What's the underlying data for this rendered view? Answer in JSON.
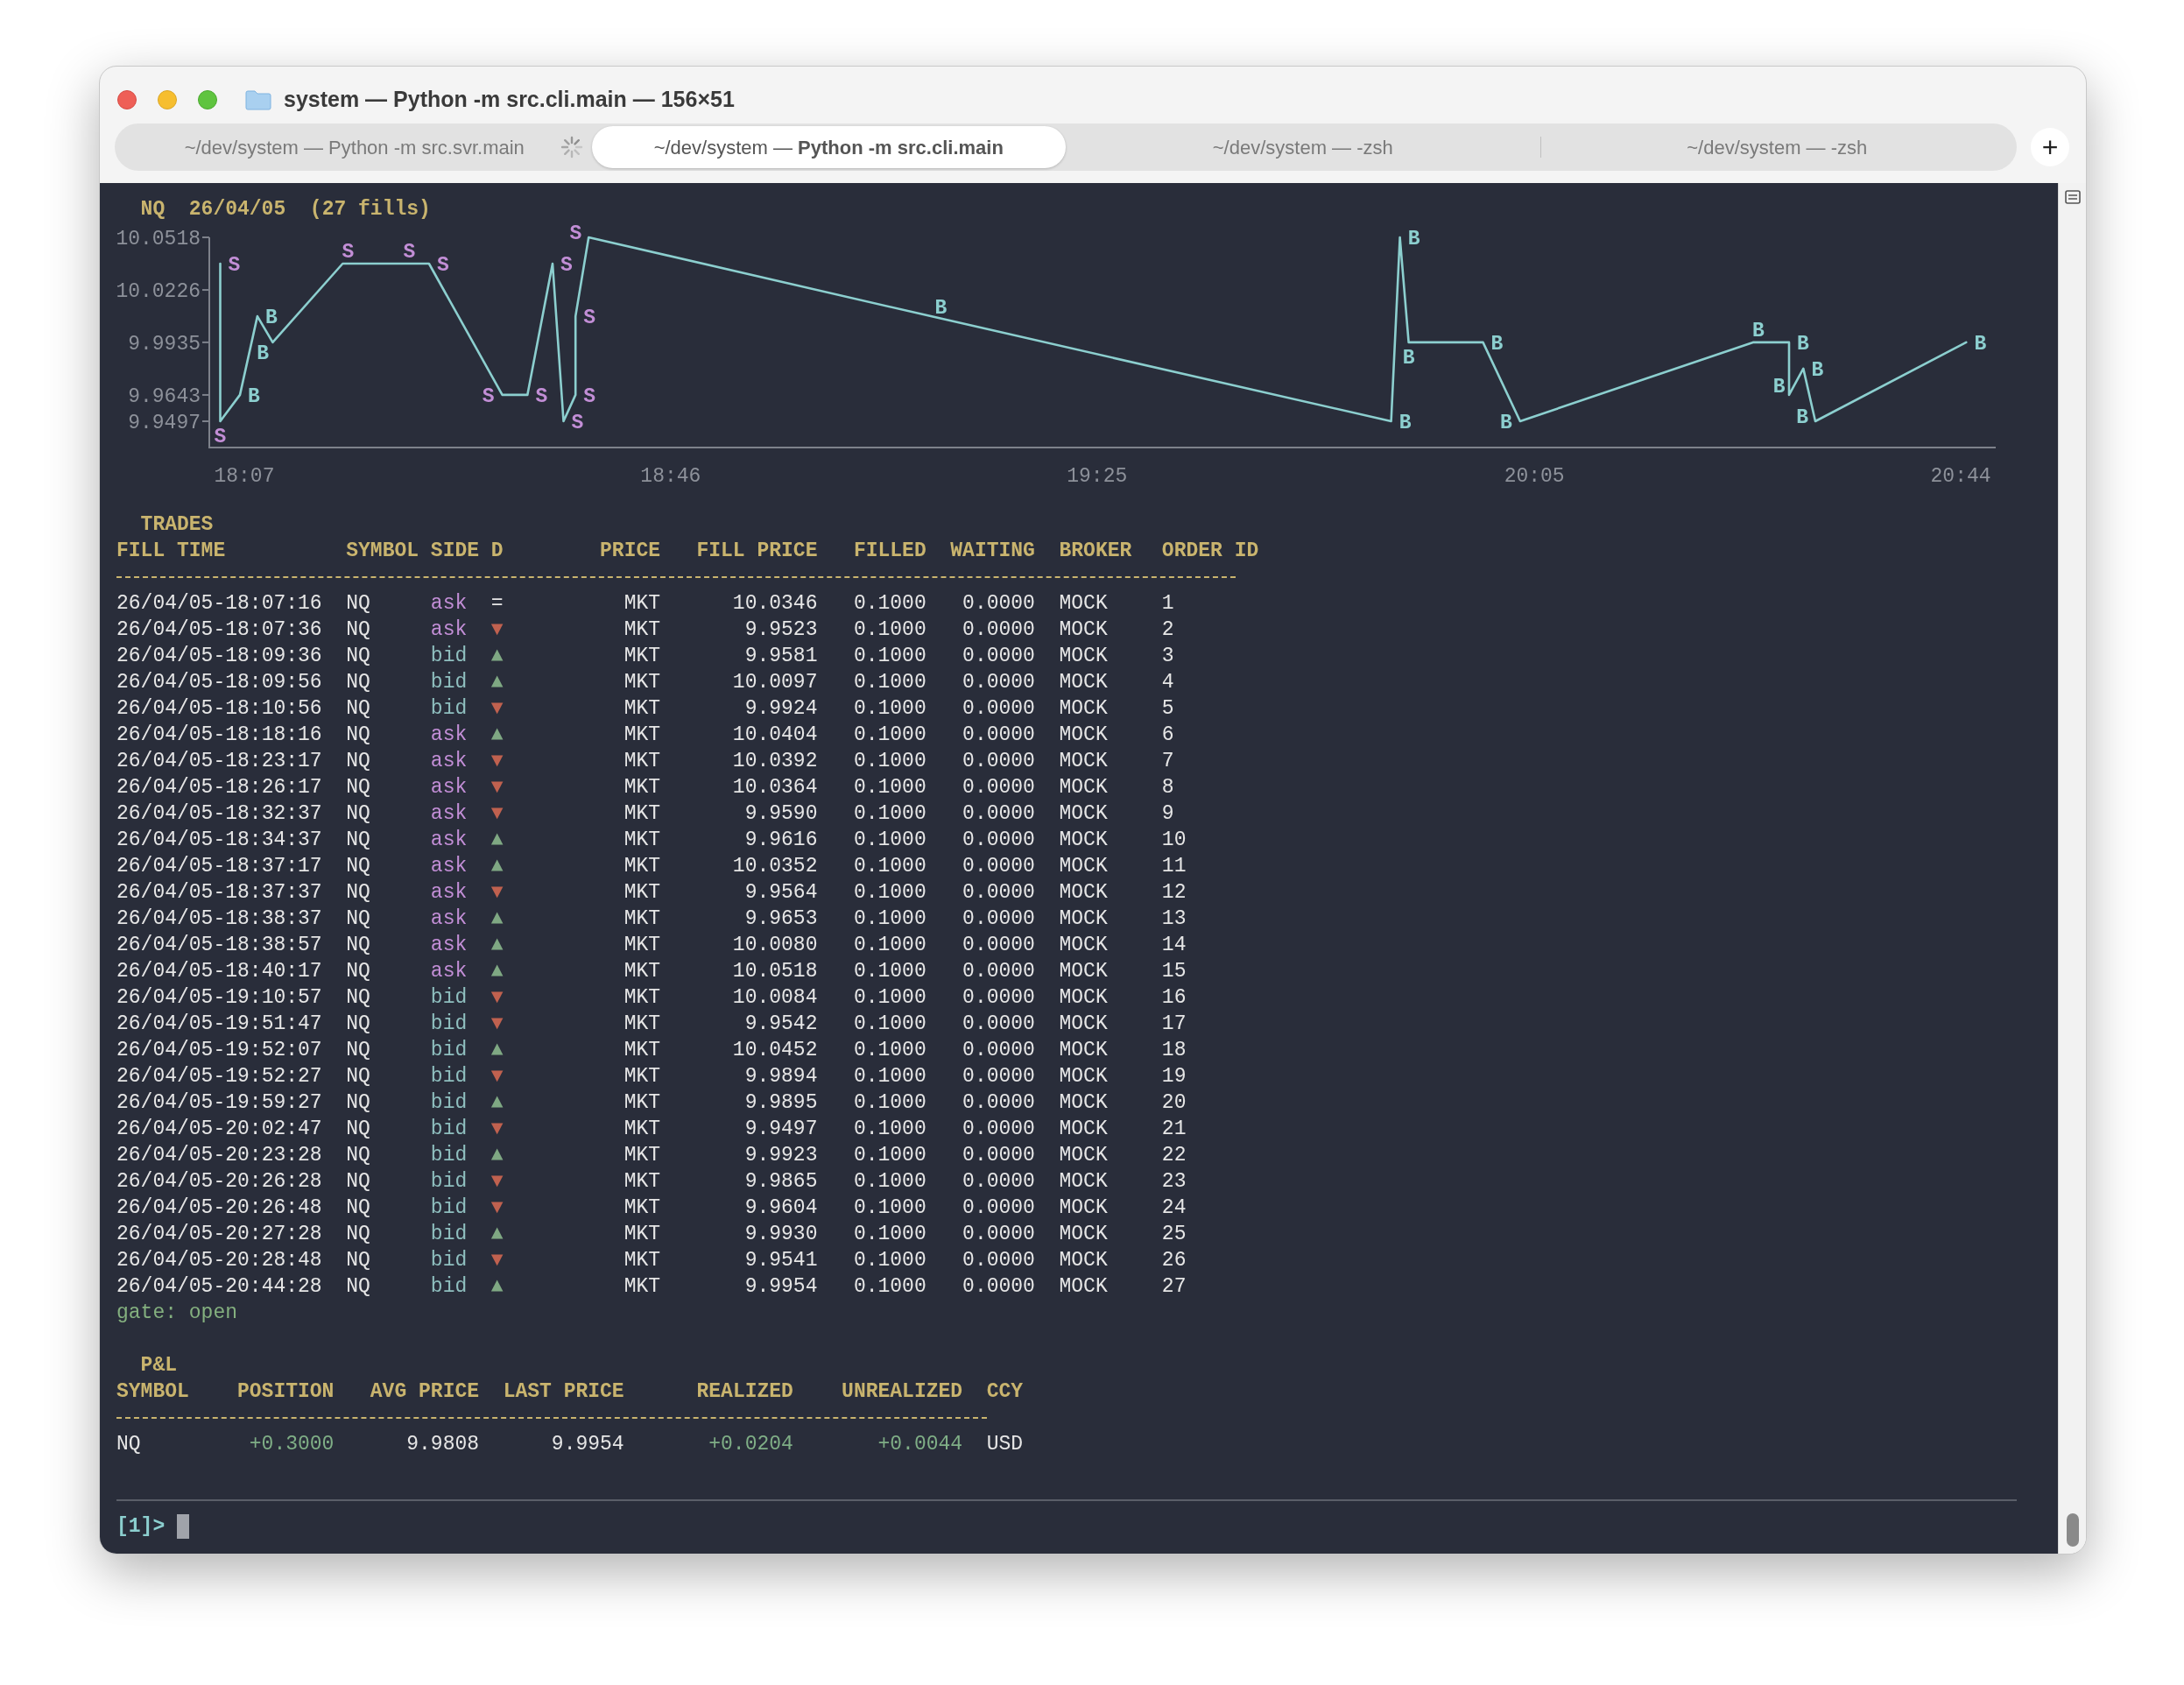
{
  "window": {
    "title": "system — Python -m src.cli.main — 156×51"
  },
  "tabs": [
    {
      "label": "~/dev/system — Python -m src.svr.main",
      "selected": false,
      "busy": true
    },
    {
      "label": "~/dev/system — **Python -m src.cli.main**",
      "selected": true,
      "busy": false
    },
    {
      "label": "~/dev/system — -zsh",
      "selected": false,
      "busy": false
    },
    {
      "label": "~/dev/system — -zsh",
      "selected": false,
      "busy": false
    }
  ],
  "new_tab_button": "+",
  "chart": {
    "title": "NQ  26/04/05  (27 fills)",
    "chart_data": {
      "type": "line",
      "xlim": [
        1083.8,
        1247.2
      ],
      "ylim": [
        9.9351,
        10.0518
      ],
      "xticks": [
        {
          "value": 1087,
          "label": "18:07"
        },
        {
          "value": 1126,
          "label": "18:46"
        },
        {
          "value": 1165,
          "label": "19:25"
        },
        {
          "value": 1205,
          "label": "20:05"
        },
        {
          "value": 1244,
          "label": "20:44"
        }
      ],
      "yticks": [
        10.0518,
        10.0226,
        9.9935,
        9.9643,
        9.9497
      ],
      "x": [
        1084.8,
        1084.8,
        1086.6,
        1088.2,
        1089.6,
        1096.0,
        1101.6,
        1103.9,
        1110.6,
        1112.9,
        1115.2,
        1116.2,
        1117.3,
        1117.3,
        1118.5,
        1149.8,
        1191.9,
        1192.7,
        1193.5,
        1200.3,
        1203.7,
        1225.0,
        1228.3,
        1228.3,
        1229.6,
        1230.7,
        1244.5
      ],
      "series": [
        {
          "color": "#8ccfcf",
          "values": [
            10.0372,
            9.9497,
            9.9643,
            10.008,
            9.9935,
            10.0372,
            10.0372,
            10.0372,
            9.9643,
            9.9643,
            10.0372,
            9.9497,
            9.9643,
            10.008,
            10.0518,
            10.008,
            9.9497,
            10.0518,
            9.9935,
            9.9935,
            9.9497,
            9.9935,
            9.9935,
            9.9643,
            9.9789,
            9.9497,
            9.9935
          ]
        }
      ]
    },
    "markers": [
      {
        "text": "S",
        "color": "#c28ed6"
      },
      {
        "text": "S",
        "color": "#c28ed6"
      },
      {
        "text": "B",
        "color": "#8ccfcf"
      },
      {
        "text": "B",
        "color": "#8ccfcf"
      },
      {
        "text": "B",
        "color": "#8ccfcf"
      },
      {
        "text": "S",
        "color": "#c28ed6"
      },
      {
        "text": "S",
        "color": "#c28ed6"
      },
      {
        "text": "S",
        "color": "#c28ed6"
      },
      {
        "text": "S",
        "color": "#c28ed6"
      },
      {
        "text": "S",
        "color": "#c28ed6"
      },
      {
        "text": "S",
        "color": "#c28ed6"
      },
      {
        "text": "S",
        "color": "#c28ed6"
      },
      {
        "text": "S",
        "color": "#c28ed6"
      },
      {
        "text": "S",
        "color": "#c28ed6"
      },
      {
        "text": "S",
        "color": "#c28ed6"
      },
      {
        "text": "B",
        "color": "#8ccfcf"
      },
      {
        "text": "B",
        "color": "#8ccfcf"
      },
      {
        "text": "B",
        "color": "#8ccfcf"
      },
      {
        "text": "B",
        "color": "#8ccfcf"
      },
      {
        "text": "B",
        "color": "#8ccfcf"
      },
      {
        "text": "B",
        "color": "#8ccfcf"
      },
      {
        "text": "B",
        "color": "#8ccfcf"
      },
      {
        "text": "B",
        "color": "#8ccfcf"
      },
      {
        "text": "B",
        "color": "#8ccfcf"
      },
      {
        "text": "B",
        "color": "#8ccfcf"
      },
      {
        "text": "B",
        "color": "#8ccfcf"
      },
      {
        "text": "B",
        "color": "#8ccfcf"
      }
    ]
  },
  "trades": {
    "title": "TRADES",
    "columns": [
      "FILL TIME",
      "SYMBOL",
      "SIDE",
      "D",
      "PRICE",
      "FILL PRICE",
      "FILLED",
      "WAITING",
      "BROKER",
      "ORDER ID"
    ],
    "rows": [
      {
        "fill_time": "26/04/05-18:07:16",
        "symbol": "NQ",
        "side": {
          "text": "ask",
          "color": "#c28ed6"
        },
        "d": {
          "text": "=",
          "color": "#e6e6e6"
        },
        "price": "MKT",
        "fill_price": "10.0346",
        "filled": "0.1000",
        "waiting": "0.0000",
        "broker": "MOCK",
        "order_id": "1"
      },
      {
        "fill_time": "26/04/05-18:07:36",
        "symbol": "NQ",
        "side": {
          "text": "ask",
          "color": "#c28ed6"
        },
        "d": {
          "text": "▼",
          "color": "#c0614f"
        },
        "price": "MKT",
        "fill_price": "9.9523",
        "filled": "0.1000",
        "waiting": "0.0000",
        "broker": "MOCK",
        "order_id": "2"
      },
      {
        "fill_time": "26/04/05-18:09:36",
        "symbol": "NQ",
        "side": {
          "text": "bid",
          "color": "#8fbfbf"
        },
        "d": {
          "text": "▲",
          "color": "#7fa883"
        },
        "price": "MKT",
        "fill_price": "9.9581",
        "filled": "0.1000",
        "waiting": "0.0000",
        "broker": "MOCK",
        "order_id": "3"
      },
      {
        "fill_time": "26/04/05-18:09:56",
        "symbol": "NQ",
        "side": {
          "text": "bid",
          "color": "#8fbfbf"
        },
        "d": {
          "text": "▲",
          "color": "#7fa883"
        },
        "price": "MKT",
        "fill_price": "10.0097",
        "filled": "0.1000",
        "waiting": "0.0000",
        "broker": "MOCK",
        "order_id": "4"
      },
      {
        "fill_time": "26/04/05-18:10:56",
        "symbol": "NQ",
        "side": {
          "text": "bid",
          "color": "#8fbfbf"
        },
        "d": {
          "text": "▼",
          "color": "#c0614f"
        },
        "price": "MKT",
        "fill_price": "9.9924",
        "filled": "0.1000",
        "waiting": "0.0000",
        "broker": "MOCK",
        "order_id": "5"
      },
      {
        "fill_time": "26/04/05-18:18:16",
        "symbol": "NQ",
        "side": {
          "text": "ask",
          "color": "#c28ed6"
        },
        "d": {
          "text": "▲",
          "color": "#7fa883"
        },
        "price": "MKT",
        "fill_price": "10.0404",
        "filled": "0.1000",
        "waiting": "0.0000",
        "broker": "MOCK",
        "order_id": "6"
      },
      {
        "fill_time": "26/04/05-18:23:17",
        "symbol": "NQ",
        "side": {
          "text": "ask",
          "color": "#c28ed6"
        },
        "d": {
          "text": "▼",
          "color": "#c0614f"
        },
        "price": "MKT",
        "fill_price": "10.0392",
        "filled": "0.1000",
        "waiting": "0.0000",
        "broker": "MOCK",
        "order_id": "7"
      },
      {
        "fill_time": "26/04/05-18:26:17",
        "symbol": "NQ",
        "side": {
          "text": "ask",
          "color": "#c28ed6"
        },
        "d": {
          "text": "▼",
          "color": "#c0614f"
        },
        "price": "MKT",
        "fill_price": "10.0364",
        "filled": "0.1000",
        "waiting": "0.0000",
        "broker": "MOCK",
        "order_id": "8"
      },
      {
        "fill_time": "26/04/05-18:32:37",
        "symbol": "NQ",
        "side": {
          "text": "ask",
          "color": "#c28ed6"
        },
        "d": {
          "text": "▼",
          "color": "#c0614f"
        },
        "price": "MKT",
        "fill_price": "9.9590",
        "filled": "0.1000",
        "waiting": "0.0000",
        "broker": "MOCK",
        "order_id": "9"
      },
      {
        "fill_time": "26/04/05-18:34:37",
        "symbol": "NQ",
        "side": {
          "text": "ask",
          "color": "#c28ed6"
        },
        "d": {
          "text": "▲",
          "color": "#7fa883"
        },
        "price": "MKT",
        "fill_price": "9.9616",
        "filled": "0.1000",
        "waiting": "0.0000",
        "broker": "MOCK",
        "order_id": "10"
      },
      {
        "fill_time": "26/04/05-18:37:17",
        "symbol": "NQ",
        "side": {
          "text": "ask",
          "color": "#c28ed6"
        },
        "d": {
          "text": "▲",
          "color": "#7fa883"
        },
        "price": "MKT",
        "fill_price": "10.0352",
        "filled": "0.1000",
        "waiting": "0.0000",
        "broker": "MOCK",
        "order_id": "11"
      },
      {
        "fill_time": "26/04/05-18:37:37",
        "symbol": "NQ",
        "side": {
          "text": "ask",
          "color": "#c28ed6"
        },
        "d": {
          "text": "▼",
          "color": "#c0614f"
        },
        "price": "MKT",
        "fill_price": "9.9564",
        "filled": "0.1000",
        "waiting": "0.0000",
        "broker": "MOCK",
        "order_id": "12"
      },
      {
        "fill_time": "26/04/05-18:38:37",
        "symbol": "NQ",
        "side": {
          "text": "ask",
          "color": "#c28ed6"
        },
        "d": {
          "text": "▲",
          "color": "#7fa883"
        },
        "price": "MKT",
        "fill_price": "9.9653",
        "filled": "0.1000",
        "waiting": "0.0000",
        "broker": "MOCK",
        "order_id": "13"
      },
      {
        "fill_time": "26/04/05-18:38:57",
        "symbol": "NQ",
        "side": {
          "text": "ask",
          "color": "#c28ed6"
        },
        "d": {
          "text": "▲",
          "color": "#7fa883"
        },
        "price": "MKT",
        "fill_price": "10.0080",
        "filled": "0.1000",
        "waiting": "0.0000",
        "broker": "MOCK",
        "order_id": "14"
      },
      {
        "fill_time": "26/04/05-18:40:17",
        "symbol": "NQ",
        "side": {
          "text": "ask",
          "color": "#c28ed6"
        },
        "d": {
          "text": "▲",
          "color": "#7fa883"
        },
        "price": "MKT",
        "fill_price": "10.0518",
        "filled": "0.1000",
        "waiting": "0.0000",
        "broker": "MOCK",
        "order_id": "15"
      },
      {
        "fill_time": "26/04/05-19:10:57",
        "symbol": "NQ",
        "side": {
          "text": "bid",
          "color": "#8fbfbf"
        },
        "d": {
          "text": "▼",
          "color": "#c0614f"
        },
        "price": "MKT",
        "fill_price": "10.0084",
        "filled": "0.1000",
        "waiting": "0.0000",
        "broker": "MOCK",
        "order_id": "16"
      },
      {
        "fill_time": "26/04/05-19:51:47",
        "symbol": "NQ",
        "side": {
          "text": "bid",
          "color": "#8fbfbf"
        },
        "d": {
          "text": "▼",
          "color": "#c0614f"
        },
        "price": "MKT",
        "fill_price": "9.9542",
        "filled": "0.1000",
        "waiting": "0.0000",
        "broker": "MOCK",
        "order_id": "17"
      },
      {
        "fill_time": "26/04/05-19:52:07",
        "symbol": "NQ",
        "side": {
          "text": "bid",
          "color": "#8fbfbf"
        },
        "d": {
          "text": "▲",
          "color": "#7fa883"
        },
        "price": "MKT",
        "fill_price": "10.0452",
        "filled": "0.1000",
        "waiting": "0.0000",
        "broker": "MOCK",
        "order_id": "18"
      },
      {
        "fill_time": "26/04/05-19:52:27",
        "symbol": "NQ",
        "side": {
          "text": "bid",
          "color": "#8fbfbf"
        },
        "d": {
          "text": "▼",
          "color": "#c0614f"
        },
        "price": "MKT",
        "fill_price": "9.9894",
        "filled": "0.1000",
        "waiting": "0.0000",
        "broker": "MOCK",
        "order_id": "19"
      },
      {
        "fill_time": "26/04/05-19:59:27",
        "symbol": "NQ",
        "side": {
          "text": "bid",
          "color": "#8fbfbf"
        },
        "d": {
          "text": "▲",
          "color": "#7fa883"
        },
        "price": "MKT",
        "fill_price": "9.9895",
        "filled": "0.1000",
        "waiting": "0.0000",
        "broker": "MOCK",
        "order_id": "20"
      },
      {
        "fill_time": "26/04/05-20:02:47",
        "symbol": "NQ",
        "side": {
          "text": "bid",
          "color": "#8fbfbf"
        },
        "d": {
          "text": "▼",
          "color": "#c0614f"
        },
        "price": "MKT",
        "fill_price": "9.9497",
        "filled": "0.1000",
        "waiting": "0.0000",
        "broker": "MOCK",
        "order_id": "21"
      },
      {
        "fill_time": "26/04/05-20:23:28",
        "symbol": "NQ",
        "side": {
          "text": "bid",
          "color": "#8fbfbf"
        },
        "d": {
          "text": "▲",
          "color": "#7fa883"
        },
        "price": "MKT",
        "fill_price": "9.9923",
        "filled": "0.1000",
        "waiting": "0.0000",
        "broker": "MOCK",
        "order_id": "22"
      },
      {
        "fill_time": "26/04/05-20:26:28",
        "symbol": "NQ",
        "side": {
          "text": "bid",
          "color": "#8fbfbf"
        },
        "d": {
          "text": "▼",
          "color": "#c0614f"
        },
        "price": "MKT",
        "fill_price": "9.9865",
        "filled": "0.1000",
        "waiting": "0.0000",
        "broker": "MOCK",
        "order_id": "23"
      },
      {
        "fill_time": "26/04/05-20:26:48",
        "symbol": "NQ",
        "side": {
          "text": "bid",
          "color": "#8fbfbf"
        },
        "d": {
          "text": "▼",
          "color": "#c0614f"
        },
        "price": "MKT",
        "fill_price": "9.9604",
        "filled": "0.1000",
        "waiting": "0.0000",
        "broker": "MOCK",
        "order_id": "24"
      },
      {
        "fill_time": "26/04/05-20:27:28",
        "symbol": "NQ",
        "side": {
          "text": "bid",
          "color": "#8fbfbf"
        },
        "d": {
          "text": "▲",
          "color": "#7fa883"
        },
        "price": "MKT",
        "fill_price": "9.9930",
        "filled": "0.1000",
        "waiting": "0.0000",
        "broker": "MOCK",
        "order_id": "25"
      },
      {
        "fill_time": "26/04/05-20:28:48",
        "symbol": "NQ",
        "side": {
          "text": "bid",
          "color": "#8fbfbf"
        },
        "d": {
          "text": "▼",
          "color": "#c0614f"
        },
        "price": "MKT",
        "fill_price": "9.9541",
        "filled": "0.1000",
        "waiting": "0.0000",
        "broker": "MOCK",
        "order_id": "26"
      },
      {
        "fill_time": "26/04/05-20:44:28",
        "symbol": "NQ",
        "side": {
          "text": "bid",
          "color": "#8fbfbf"
        },
        "d": {
          "text": "▲",
          "color": "#7fa883"
        },
        "price": "MKT",
        "fill_price": "9.9954",
        "filled": "0.1000",
        "waiting": "0.0000",
        "broker": "MOCK",
        "order_id": "27"
      }
    ],
    "status": "gate: open"
  },
  "pnl": {
    "title": "P&L",
    "columns": [
      "SYMBOL",
      "POSITION",
      "AVG PRICE",
      "LAST PRICE",
      "REALIZED",
      "UNREALIZED",
      "CCY"
    ],
    "rows": [
      {
        "cells": [
          {
            "text": "NQ",
            "color": "#e6e6e6"
          },
          {
            "text": "+0.3000",
            "color": "#7fae86"
          },
          {
            "text": "9.9808",
            "color": "#e6e6e6"
          },
          {
            "text": "9.9954",
            "color": "#e6e6e6"
          },
          {
            "text": "+0.0204",
            "color": "#7fae86"
          },
          {
            "text": "+0.0044",
            "color": "#7fae86"
          },
          {
            "text": "USD",
            "color": "#e6e6e6"
          }
        ]
      }
    ]
  },
  "prompt": "[1]>"
}
